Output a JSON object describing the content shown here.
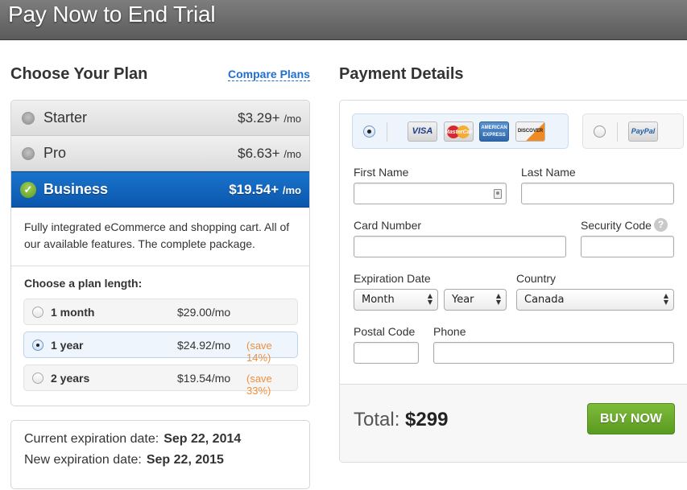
{
  "header": {
    "title": "Pay Now to End Trial"
  },
  "plans": {
    "heading": "Choose Your Plan",
    "compare_link": "Compare Plans",
    "items": [
      {
        "name": "Starter",
        "price": "$3.29+",
        "per": "/mo",
        "selected": false
      },
      {
        "name": "Pro",
        "price": "$6.63+",
        "per": "/mo",
        "selected": false
      },
      {
        "name": "Business",
        "price": "$19.54+",
        "per": "/mo",
        "selected": true
      }
    ],
    "selected_description": "Fully integrated eCommerce and shopping cart. All of our available features. The complete package.",
    "length_label": "Choose a plan length:",
    "lengths": [
      {
        "name": "1 month",
        "price": "$29.00/mo",
        "save": "",
        "selected": false
      },
      {
        "name": "1 year",
        "price": "$24.92/mo",
        "save": "(save 14%)",
        "selected": true
      },
      {
        "name": "2 years",
        "price": "$19.54/mo",
        "save": "(save 33%)",
        "selected": false
      }
    ],
    "check_glyph": "✓"
  },
  "expiration": {
    "current_label": "Current expiration date:",
    "current_value": "Sep 22, 2014",
    "new_label": "New expiration date:",
    "new_value": "Sep 22, 2015"
  },
  "payment": {
    "heading": "Payment Details",
    "methods": [
      {
        "id": "credit-card",
        "selected": true,
        "cards": [
          "VISA",
          "MasterCard",
          "AMERICAN EXPRESS",
          "DISCOVER"
        ]
      },
      {
        "id": "paypal",
        "selected": false,
        "label": "PayPal"
      }
    ],
    "fields": {
      "first_name": {
        "label": "First Name",
        "value": ""
      },
      "last_name": {
        "label": "Last Name",
        "value": ""
      },
      "card_number": {
        "label": "Card Number",
        "value": ""
      },
      "security_code": {
        "label": "Security Code",
        "value": "",
        "help_glyph": "?"
      },
      "expiration_date": {
        "label": "Expiration Date",
        "month": "Month",
        "year": "Year"
      },
      "country": {
        "label": "Country",
        "value": "Canada"
      },
      "postal_code": {
        "label": "Postal Code",
        "value": ""
      },
      "phone": {
        "label": "Phone",
        "value": ""
      }
    },
    "total_label": "Total:",
    "total_value": "$299",
    "buy_button": "BUY NOW"
  },
  "colors": {
    "accent_blue": "#1f6fd1",
    "selected_plan": "#1167c4",
    "buy_green": "#6aaa2c",
    "save_orange": "#f0903c"
  }
}
